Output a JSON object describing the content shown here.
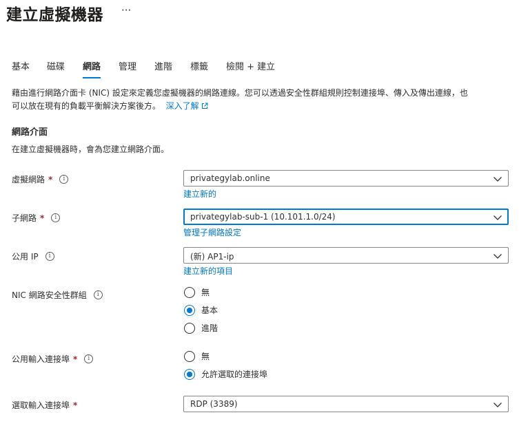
{
  "header": {
    "title": "建立虛擬機器",
    "more_label": "···"
  },
  "tabs": [
    {
      "label": "基本"
    },
    {
      "label": "磁碟"
    },
    {
      "label": "網路",
      "active": true
    },
    {
      "label": "管理"
    },
    {
      "label": "進階"
    },
    {
      "label": "標籤"
    },
    {
      "label": "檢閱 + 建立"
    }
  ],
  "description": {
    "line1": "藉由進行網路介面卡 (NIC) 設定來定義您虛擬機器的網路連線。您可以透過安全性群組規則控制連接埠、傳入及傳出連線，也",
    "line2": "可以放在現有的負載平衡解決方案後方。",
    "learn_more": "深入了解"
  },
  "section": {
    "title": "網路介面",
    "subtitle": "在建立虛擬機器時，會為您建立網路介面。"
  },
  "fields": {
    "vnet": {
      "label": "虛擬網路",
      "value": "privategylab.online",
      "link": "建立新的"
    },
    "subnet": {
      "label": "子網路",
      "value": "privategylab-sub-1 (10.101.1.0/24)",
      "link": "管理子網路設定"
    },
    "public_ip": {
      "label": "公用 IP",
      "value": "(新) AP1-ip",
      "link": "建立新的項目"
    },
    "nic_nsg": {
      "label": "NIC 網路安全性群組",
      "options": [
        "無",
        "基本",
        "進階"
      ],
      "selected": "基本"
    },
    "inbound_ports": {
      "label": "公用輸入連接埠",
      "options": [
        "無",
        "允許選取的連接埠"
      ],
      "selected": "允許選取的連接埠"
    },
    "select_ports": {
      "label": "選取輸入連接埠",
      "value": "RDP (3389)"
    }
  },
  "common": {
    "required_mark": "*",
    "info_glyph": "i"
  },
  "colors": {
    "accent": "#0078d4",
    "required": "#a4262c",
    "text": "#323130",
    "border": "#8a8886"
  }
}
